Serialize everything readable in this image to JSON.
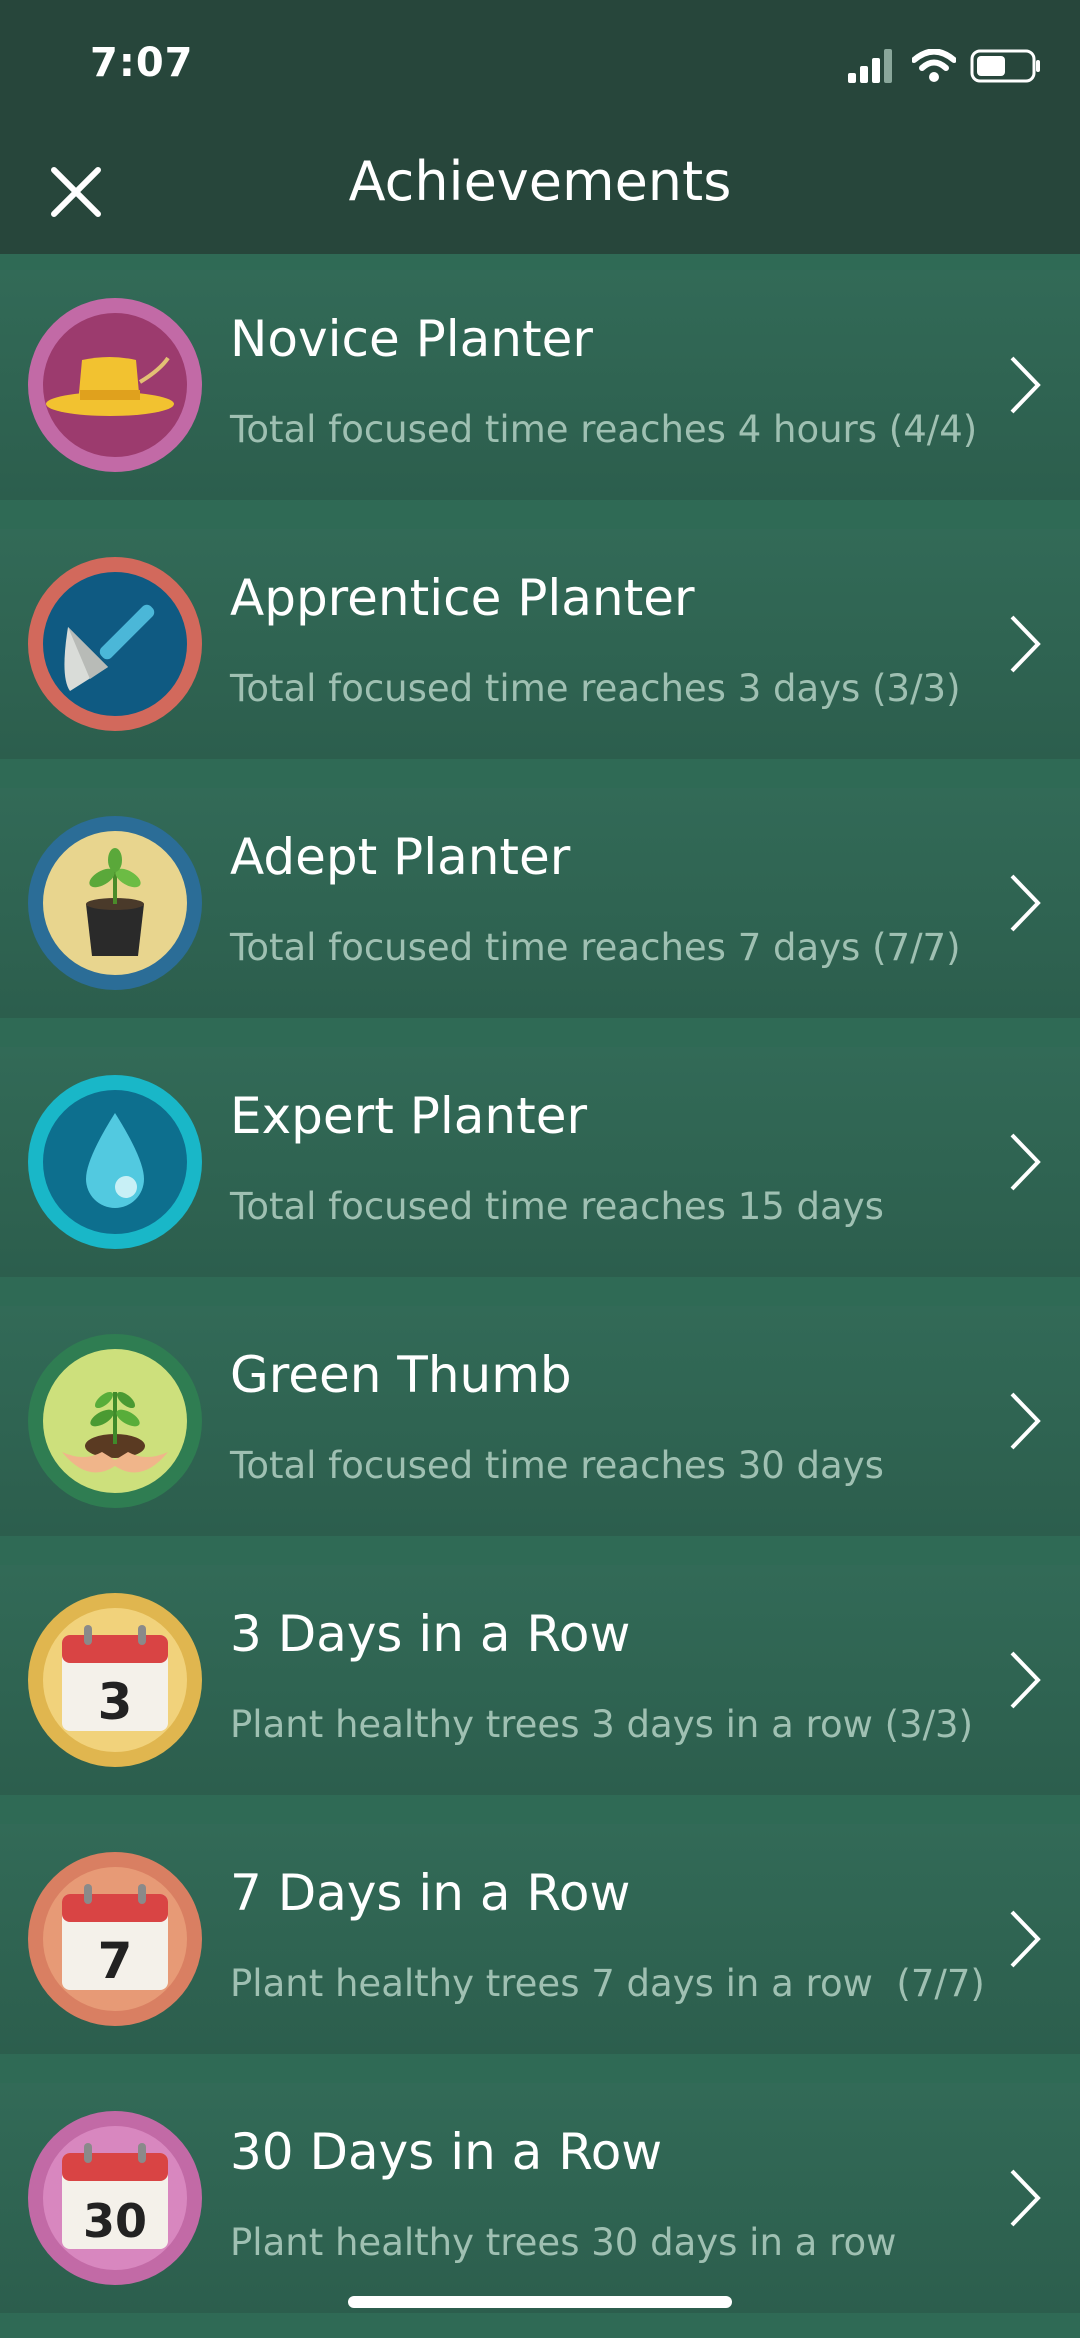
{
  "status": {
    "time": "7:07"
  },
  "header": {
    "title": "Achievements"
  },
  "achievements": [
    {
      "title": "Novice Planter",
      "subtitle": "Total focused time reaches 4 hours (4/4)",
      "icon": "straw-hat-icon",
      "ring": "#c26aa6",
      "inner": "#9c3b6e"
    },
    {
      "title": "Apprentice Planter",
      "subtitle": "Total focused time reaches 3 days (3/3)",
      "icon": "trowel-icon",
      "ring": "#d2695c",
      "inner": "#0f5a82"
    },
    {
      "title": "Adept Planter",
      "subtitle": "Total focused time reaches 7 days (7/7)",
      "icon": "potted-plant-icon",
      "ring": "#2b6d97",
      "inner": "#e8d58e"
    },
    {
      "title": "Expert Planter",
      "subtitle": "Total focused time reaches 15 days",
      "icon": "water-drop-icon",
      "ring": "#19b7c8",
      "inner": "#0d6f8e"
    },
    {
      "title": "Green Thumb",
      "subtitle": "Total focused time reaches 30 days",
      "icon": "seedling-hands-icon",
      "ring": "#2f7d52",
      "inner": "#cde07c"
    },
    {
      "title": "3 Days in a Row",
      "subtitle": "Plant healthy trees 3 days in a row (3/3)",
      "icon": "calendar-icon",
      "calendar_number": "3",
      "ring": "#e0b64f",
      "inner": "#f1d27b"
    },
    {
      "title": "7 Days in a Row",
      "subtitle": "Plant healthy trees 7 days in a row  (7/7)",
      "icon": "calendar-icon",
      "calendar_number": "7",
      "ring": "#d97f62",
      "inner": "#e79a76"
    },
    {
      "title": "30 Days in a Row",
      "subtitle": "Plant healthy trees 30 days in a row",
      "icon": "calendar-icon",
      "calendar_number": "30",
      "ring": "#c26aa6",
      "inner": "#d887bf"
    }
  ]
}
